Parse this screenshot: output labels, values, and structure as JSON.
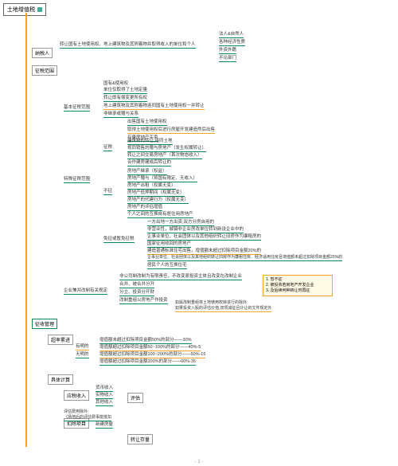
{
  "root": "土地增值税",
  "sections": {
    "s1": {
      "title": "纳税人",
      "desc": "转让国有土地使用权、地上建筑物及其附着物并取得收入的单位和个人",
      "items": [
        "法人&自然人",
        "各种经济性质",
        "外资外籍",
        "不论部门"
      ]
    },
    "s2": {
      "title": "征税范围",
      "basic": {
        "label": "基本征税范围",
        "b1": "国有&使用权\n单位仅取得了土地定量",
        "b2": "转让即有偿变更所有权",
        "b3": "地上建筑物及其附着物连同国有土地使用权一并转让",
        "b4": "非继承或赠与关系",
        "b5": "出售国有土地使用权",
        "b6": "取得土地使用权后进行房屋开发建造然后出售",
        "b7": "存量房地产买卖"
      },
      "special": {
        "label": "特殊征税范围",
        "levy": {
          "label": "征税",
          "items": [
            "建筑物的转让,连同土地",
            "视同销售的赠与房地产（发生权属转让）",
            "转让之间交易房地产（首次物态收入）",
            "合作建房建成后转让的"
          ]
        },
        "exempt": {
          "label": "不征",
          "items": [
            "房地产继承（权益）",
            "房地产赠与（将国有限定、无收入）",
            "房地产出租（权属无变）",
            "房地产低押期间（权属无变）",
            "房地产的代建行为（权属无变）",
            "房地产的评估增值",
            "个人之间的互换自有居住用房地产"
          ]
        },
        "relief": {
          "label": "免征或暂免征税",
          "items": [
            "一方出地一方出资,双方分房自用的",
            "非营业性，城镇非企业房改单位转到新设企业中的",
            "企事业单位，社会团体以及其他组织转让旧房作为廉租房的",
            "国家征用收回的房地产",
            "建造普通标准住宅出售，增值额未超过扣除项目金额20%的",
            "企事业单位、社会团体以及其他组织转让旧房作为廉租住房、经济适用住房且增值额未超过扣除项目金额20%的",
            "居民个人的互换住宅"
          ]
        }
      },
      "corp": {
        "label": "企业兼并改制有关规定",
        "c1": "非公司制改制为有限责任，不改变原投资主体且改变在改制企业",
        "c2": "合并、被合并分开",
        "c3": "分立、投资分开财",
        "c4": "改制重组以房地产作投资",
        "c5note": "如属改制重组将土地使用权转进行的除外\n如果投资入股的评估价值,双项减征且计让的文件规定外",
        "box": [
          "1. 暂不征",
          "2. 被投资若房地产开发企业",
          "3. 及后续何种转让时再征"
        ]
      }
    },
    "s3": {
      "title": "征收管理",
      "rate": {
        "label": "超率累进",
        "r1": "有明的",
        "r2": "无明的",
        "tiers": [
          "增值额未超过扣除项目金额50%的部分——30%",
          "增值额超过扣除项目金额50~100%的部分——40%-5",
          "增值额超过扣除项目金额100~200%的部分——50%-15",
          "增值额超过扣除项目金额200%的部分——60%-35"
        ]
      },
      "calc": {
        "label": "具体计算",
        "income": {
          "label": "应税收入",
          "items": [
            "货币收入",
            "实物收入",
            "其他收入"
          ],
          "note": "评估"
        },
        "deduct": {
          "label": "扣除项目",
          "sub1": "评估费用除外\n（场地后的评估费事能抵扣",
          "sub2": "新建房屋",
          "sub3": "转让存量"
        }
      }
    }
  },
  "page": "- 1 -"
}
